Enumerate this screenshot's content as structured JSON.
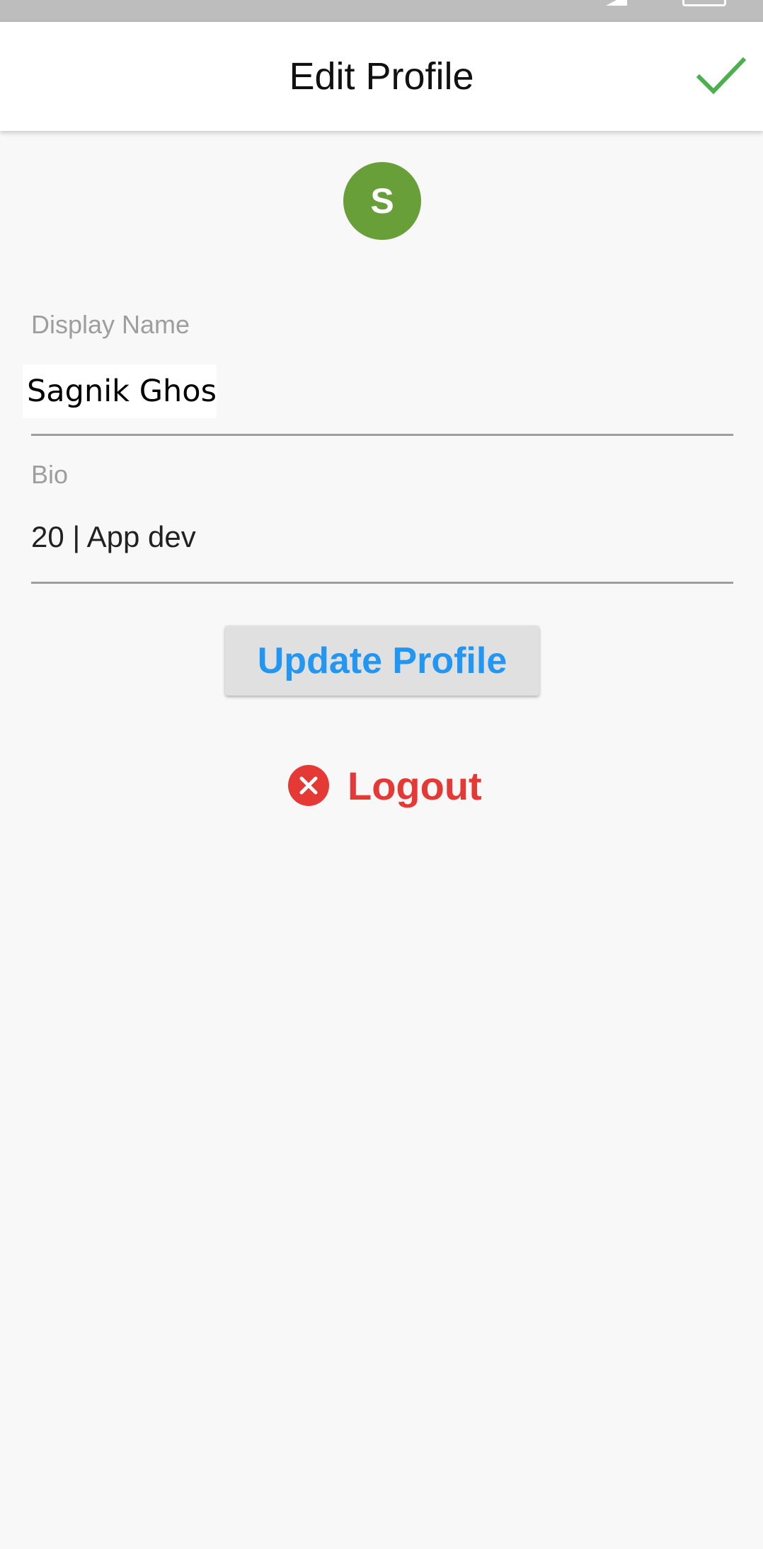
{
  "app_bar": {
    "title": "Edit Profile",
    "confirm_icon": "check-icon"
  },
  "avatar": {
    "initial": "S",
    "color": "#689f38"
  },
  "form": {
    "display_name": {
      "label": "Display Name",
      "value": "Sagnik Ghosh"
    },
    "bio": {
      "label": "Bio",
      "value": "20 | App dev"
    }
  },
  "actions": {
    "update_label": "Update Profile",
    "logout_label": "Logout",
    "logout_icon": "close-circle-icon"
  },
  "colors": {
    "accent_blue": "#2196f3",
    "danger_red": "#e53935",
    "confirm_green": "#4caf50"
  }
}
